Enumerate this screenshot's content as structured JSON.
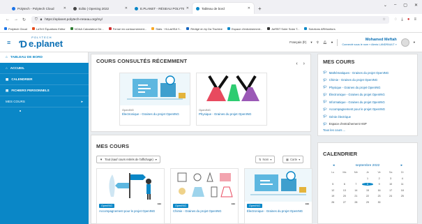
{
  "browser": {
    "tabs": [
      {
        "label": "Polytech - Polytech Cloud",
        "color": "#1a73e8",
        "active": false
      },
      {
        "label": "Edito | Opening 2022",
        "color": "#444444",
        "active": false
      },
      {
        "label": "E.PLANET - RÉSEAU POLYTECH",
        "color": "#0a87c7",
        "active": false
      },
      {
        "label": "Tableau de bord",
        "color": "#0a87c7",
        "active": true
      }
    ],
    "url": "https://eplanet.polytech-reseau.org/my/",
    "bookmarks": [
      {
        "label": "Polytech Cloud",
        "color": "#1a73e8"
      },
      {
        "label": "LaTeX Équations Editor",
        "color": "#e84a1a"
      },
      {
        "label": "NOAA Calculateur De...",
        "color": "#2e7d32"
      },
      {
        "label": "Ferrari en contournement...",
        "color": "#d32f2f"
      },
      {
        "label": "Stats · Hi-Lat/ISA Y...",
        "color": "#f9a825"
      },
      {
        "label": "Rédigé en by Da Tischine",
        "color": "#1565c0"
      },
      {
        "label": "Espace d'entraînement...",
        "color": "#0a87c7"
      },
      {
        "label": "AeRBT Soler Solar T...",
        "color": "#333333"
      },
      {
        "label": "Solutions ARMonitors",
        "color": "#0a87c7"
      }
    ]
  },
  "header": {
    "logo_small": "POLYTECH",
    "logo_big": "e.planet",
    "language": "Français (fr)",
    "user_name": "Mohamed Meftah",
    "user_sub": "Connecté sous le nom « Alexis LANDRAULT »"
  },
  "sidebar": {
    "dashboard": "TABLEAU DE BORD",
    "items": [
      {
        "label": "ACCUEIL",
        "icon": "home-icon"
      },
      {
        "label": "CALENDRIER",
        "icon": "calendar-icon"
      },
      {
        "label": "FICHIERS PERSONNELS",
        "icon": "file-icon"
      },
      {
        "label": "MES COURS",
        "icon": "none"
      }
    ]
  },
  "recent": {
    "title": "COURS CONSULTÉS RÉCEMMENT",
    "cards": [
      {
        "category": "OpenING",
        "title": "Électronique - Graines du projet OpenING"
      },
      {
        "category": "OpenING",
        "title": "Physique - Graines du projet OpenING"
      }
    ]
  },
  "mescourses": {
    "title": "MES COURS",
    "filter": "Tout (sauf cours retirés de l'affichage)",
    "sort": "Nom",
    "view": "Carte",
    "cards": [
      {
        "badge": "OpenING",
        "title": "Accompagnement pour le projet OpenING"
      },
      {
        "badge": "OpenING",
        "title": "Chimie - Graines du projet OpenING"
      },
      {
        "badge": "OpenING",
        "title": "Électronique - Graines du projet OpenING"
      }
    ]
  },
  "mycourses_block": {
    "title": "MES COURS",
    "items": [
      {
        "label": "Mathématiques - Graines du projet OpenING",
        "dark": false
      },
      {
        "label": "Chimie - Graines du projet OpenING",
        "dark": false
      },
      {
        "label": "Physique - Graines du projet OpenING",
        "dark": false
      },
      {
        "label": "Électronique - Graines du projet OpenING",
        "dark": false
      },
      {
        "label": "Informatique - Graines du projet OpenING",
        "dark": false
      },
      {
        "label": "Accompagnement pour le projet OpenING",
        "dark": false
      },
      {
        "label": "Génie électrique",
        "dark": false
      },
      {
        "label": "Espace d'entraînement HSP",
        "dark": true
      }
    ],
    "all": "Tous les cours ..."
  },
  "calendar": {
    "title": "CALENDRIER",
    "month": "septembre 2022",
    "days": [
      "Lu",
      "Ma",
      "Me",
      "Je",
      "Ve",
      "Sa",
      "Di"
    ],
    "cells": [
      "",
      "",
      "",
      "1",
      "2",
      "3",
      "4",
      "5",
      "6",
      "7",
      "8",
      "9",
      "10",
      "11",
      "12",
      "13",
      "14",
      "15",
      "16",
      "17",
      "18",
      "19",
      "20",
      "21",
      "22",
      "23",
      "24",
      "25",
      "26",
      "27",
      "28",
      "29",
      "30",
      "",
      ""
    ],
    "today": "8"
  }
}
